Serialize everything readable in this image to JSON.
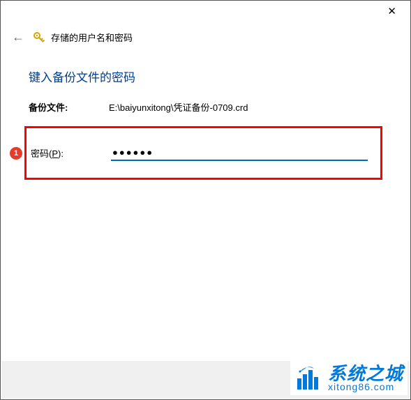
{
  "titlebar": {
    "close": "✕"
  },
  "header": {
    "title": "存储的用户名和密码"
  },
  "content": {
    "instruction": "键入备份文件的密码",
    "backup_label": "备份文件:",
    "backup_path": "E:\\baiyunxitong\\凭证备份-0709.crd",
    "password_label_prefix": "密码(",
    "password_label_key": "P",
    "password_label_suffix": "):",
    "password_value": "●●●●●●"
  },
  "marker": {
    "number": "1"
  },
  "watermark": {
    "main": "系统之城",
    "url": "xitong86.com"
  }
}
